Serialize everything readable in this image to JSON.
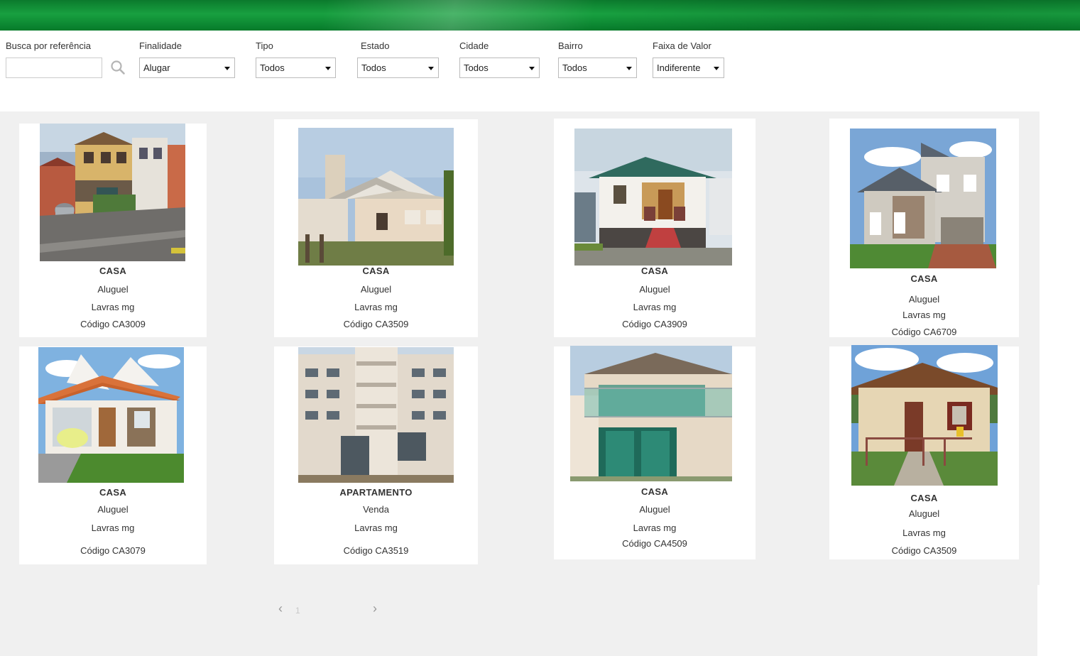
{
  "filters": {
    "ref": {
      "label": "Busca por referência",
      "value": ""
    },
    "finalidade": {
      "label": "Finalidade",
      "value": "Alugar"
    },
    "tipo": {
      "label": "Tipo",
      "value": "Todos"
    },
    "estado": {
      "label": "Estado",
      "value": "Todos"
    },
    "cidade": {
      "label": "Cidade",
      "value": "Todos"
    },
    "bairro": {
      "label": "Bairro",
      "value": "Todos"
    },
    "valor": {
      "label": "Faixa de Valor",
      "value": "Indiferente"
    }
  },
  "listings": [
    {
      "type": "CASA",
      "purpose": "Aluguel",
      "city": "Lavras mg",
      "code": "Código CA3009"
    },
    {
      "type": "CASA",
      "purpose": "Aluguel",
      "city": "Lavras mg",
      "code": "Código CA3509"
    },
    {
      "type": "CASA",
      "purpose": "Aluguel",
      "city": "Lavras mg",
      "code": "Código CA3909"
    },
    {
      "type": "CASA",
      "purpose": "Aluguel",
      "city": "Lavras mg",
      "code": "Código CA6709"
    },
    {
      "type": "CASA",
      "purpose": "Aluguel",
      "city": "Lavras mg",
      "code": "Código CA3079"
    },
    {
      "type": "APARTAMENTO",
      "purpose": "Venda",
      "city": "Lavras mg",
      "code": "Código CA3519"
    },
    {
      "type": "CASA",
      "purpose": "Aluguel",
      "city": "Lavras mg",
      "code": "Código CA4509"
    },
    {
      "type": "CASA",
      "purpose": "Aluguel",
      "city": "Lavras mg",
      "code": "Código CA3509"
    }
  ],
  "pagination": {
    "prev": "‹",
    "page": "1",
    "next": "›"
  },
  "colors": {
    "banner_green": "#0b7a2c",
    "results_bg": "#f0f0f0"
  }
}
